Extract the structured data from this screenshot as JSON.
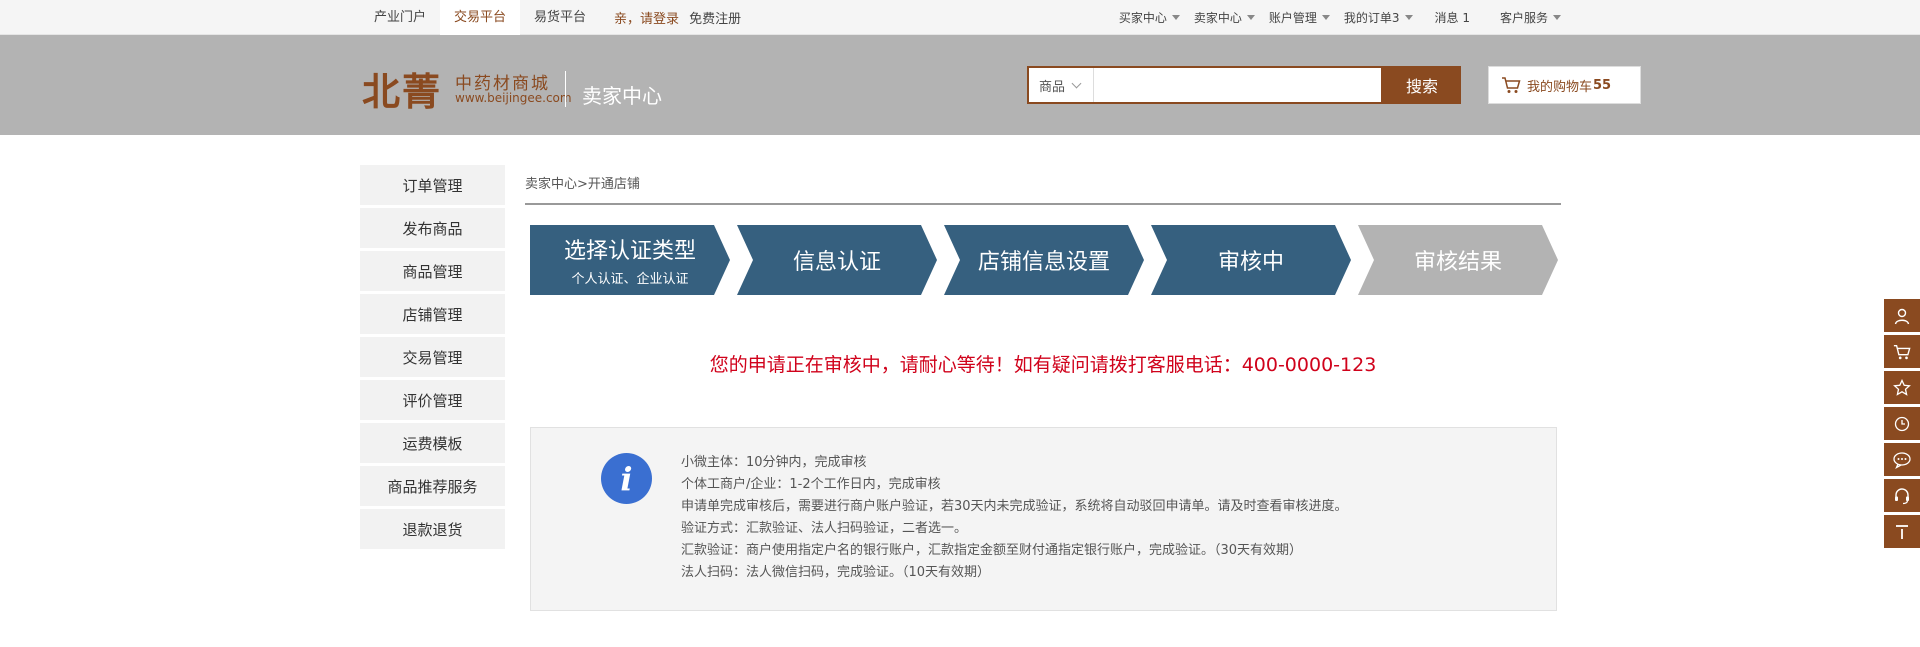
{
  "topbar": {
    "left_links": [
      "产业门户",
      "交易平台",
      "易货平台"
    ],
    "login": "亲，请登录",
    "register": "免费注册",
    "right_links": [
      {
        "label": "买家中心",
        "dropdown": true
      },
      {
        "label": "卖家中心",
        "dropdown": true
      },
      {
        "label": "账户管理",
        "dropdown": true
      },
      {
        "label": "我的订单3",
        "dropdown": true
      },
      {
        "label": "消息 1",
        "dropdown": false
      },
      {
        "label": "客户服务",
        "dropdown": true
      }
    ]
  },
  "header": {
    "logo_main": "北菁",
    "logo_sub": "中药材商城",
    "logo_url": "www.beijingee.com",
    "section_title": "卖家中心",
    "search": {
      "category": "商品",
      "placeholder": "",
      "button": "搜索"
    },
    "cart": {
      "label": "我的购物车",
      "count": "55"
    }
  },
  "sidebar": {
    "items": [
      "订单管理",
      "发布商品",
      "商品管理",
      "店铺管理",
      "交易管理",
      "评价管理",
      "运费模板",
      "商品推荐服务",
      "退款退货"
    ]
  },
  "breadcrumb": "卖家中心>开通店铺",
  "steps": [
    {
      "title": "选择认证类型",
      "sub": "个人认证、企业认证",
      "state": "done"
    },
    {
      "title": "信息认证",
      "sub": "",
      "state": "done"
    },
    {
      "title": "店铺信息设置",
      "sub": "",
      "state": "done"
    },
    {
      "title": "审核中",
      "sub": "",
      "state": "done"
    },
    {
      "title": "审核结果",
      "sub": "",
      "state": "pending"
    }
  ],
  "notice": "您的申请正在审核中，请耐心等待！如有疑问请拨打客服电话：400-0000-123",
  "info": {
    "lines": [
      "小微主体：10分钟内，完成审核",
      "个体工商户/企业：1-2个工作日内，完成审核",
      "申请单完成审核后，需要进行商户账户验证，若30天内未完成验证，系统将自动驳回申请单。请及时查看审核进度。",
      "验证方式：汇款验证、法人扫码验证，二者选一。",
      "汇款验证：商户使用指定户名的银行账户，汇款指定金额至财付通指定银行账户，完成验证。（30天有效期）",
      "法人扫码：法人微信扫码，完成验证。（10天有效期）"
    ]
  },
  "floatbar": {
    "items": [
      "user-icon",
      "cart-icon",
      "star-icon",
      "history-icon",
      "chat-icon",
      "headset-icon",
      "back-to-top-icon"
    ]
  },
  "colors": {
    "brand": "#8a4a20",
    "step_active": "#36607f",
    "step_pending": "#b3b3b3",
    "notice": "#d0021b",
    "info_icon": "#3a6fd1"
  }
}
